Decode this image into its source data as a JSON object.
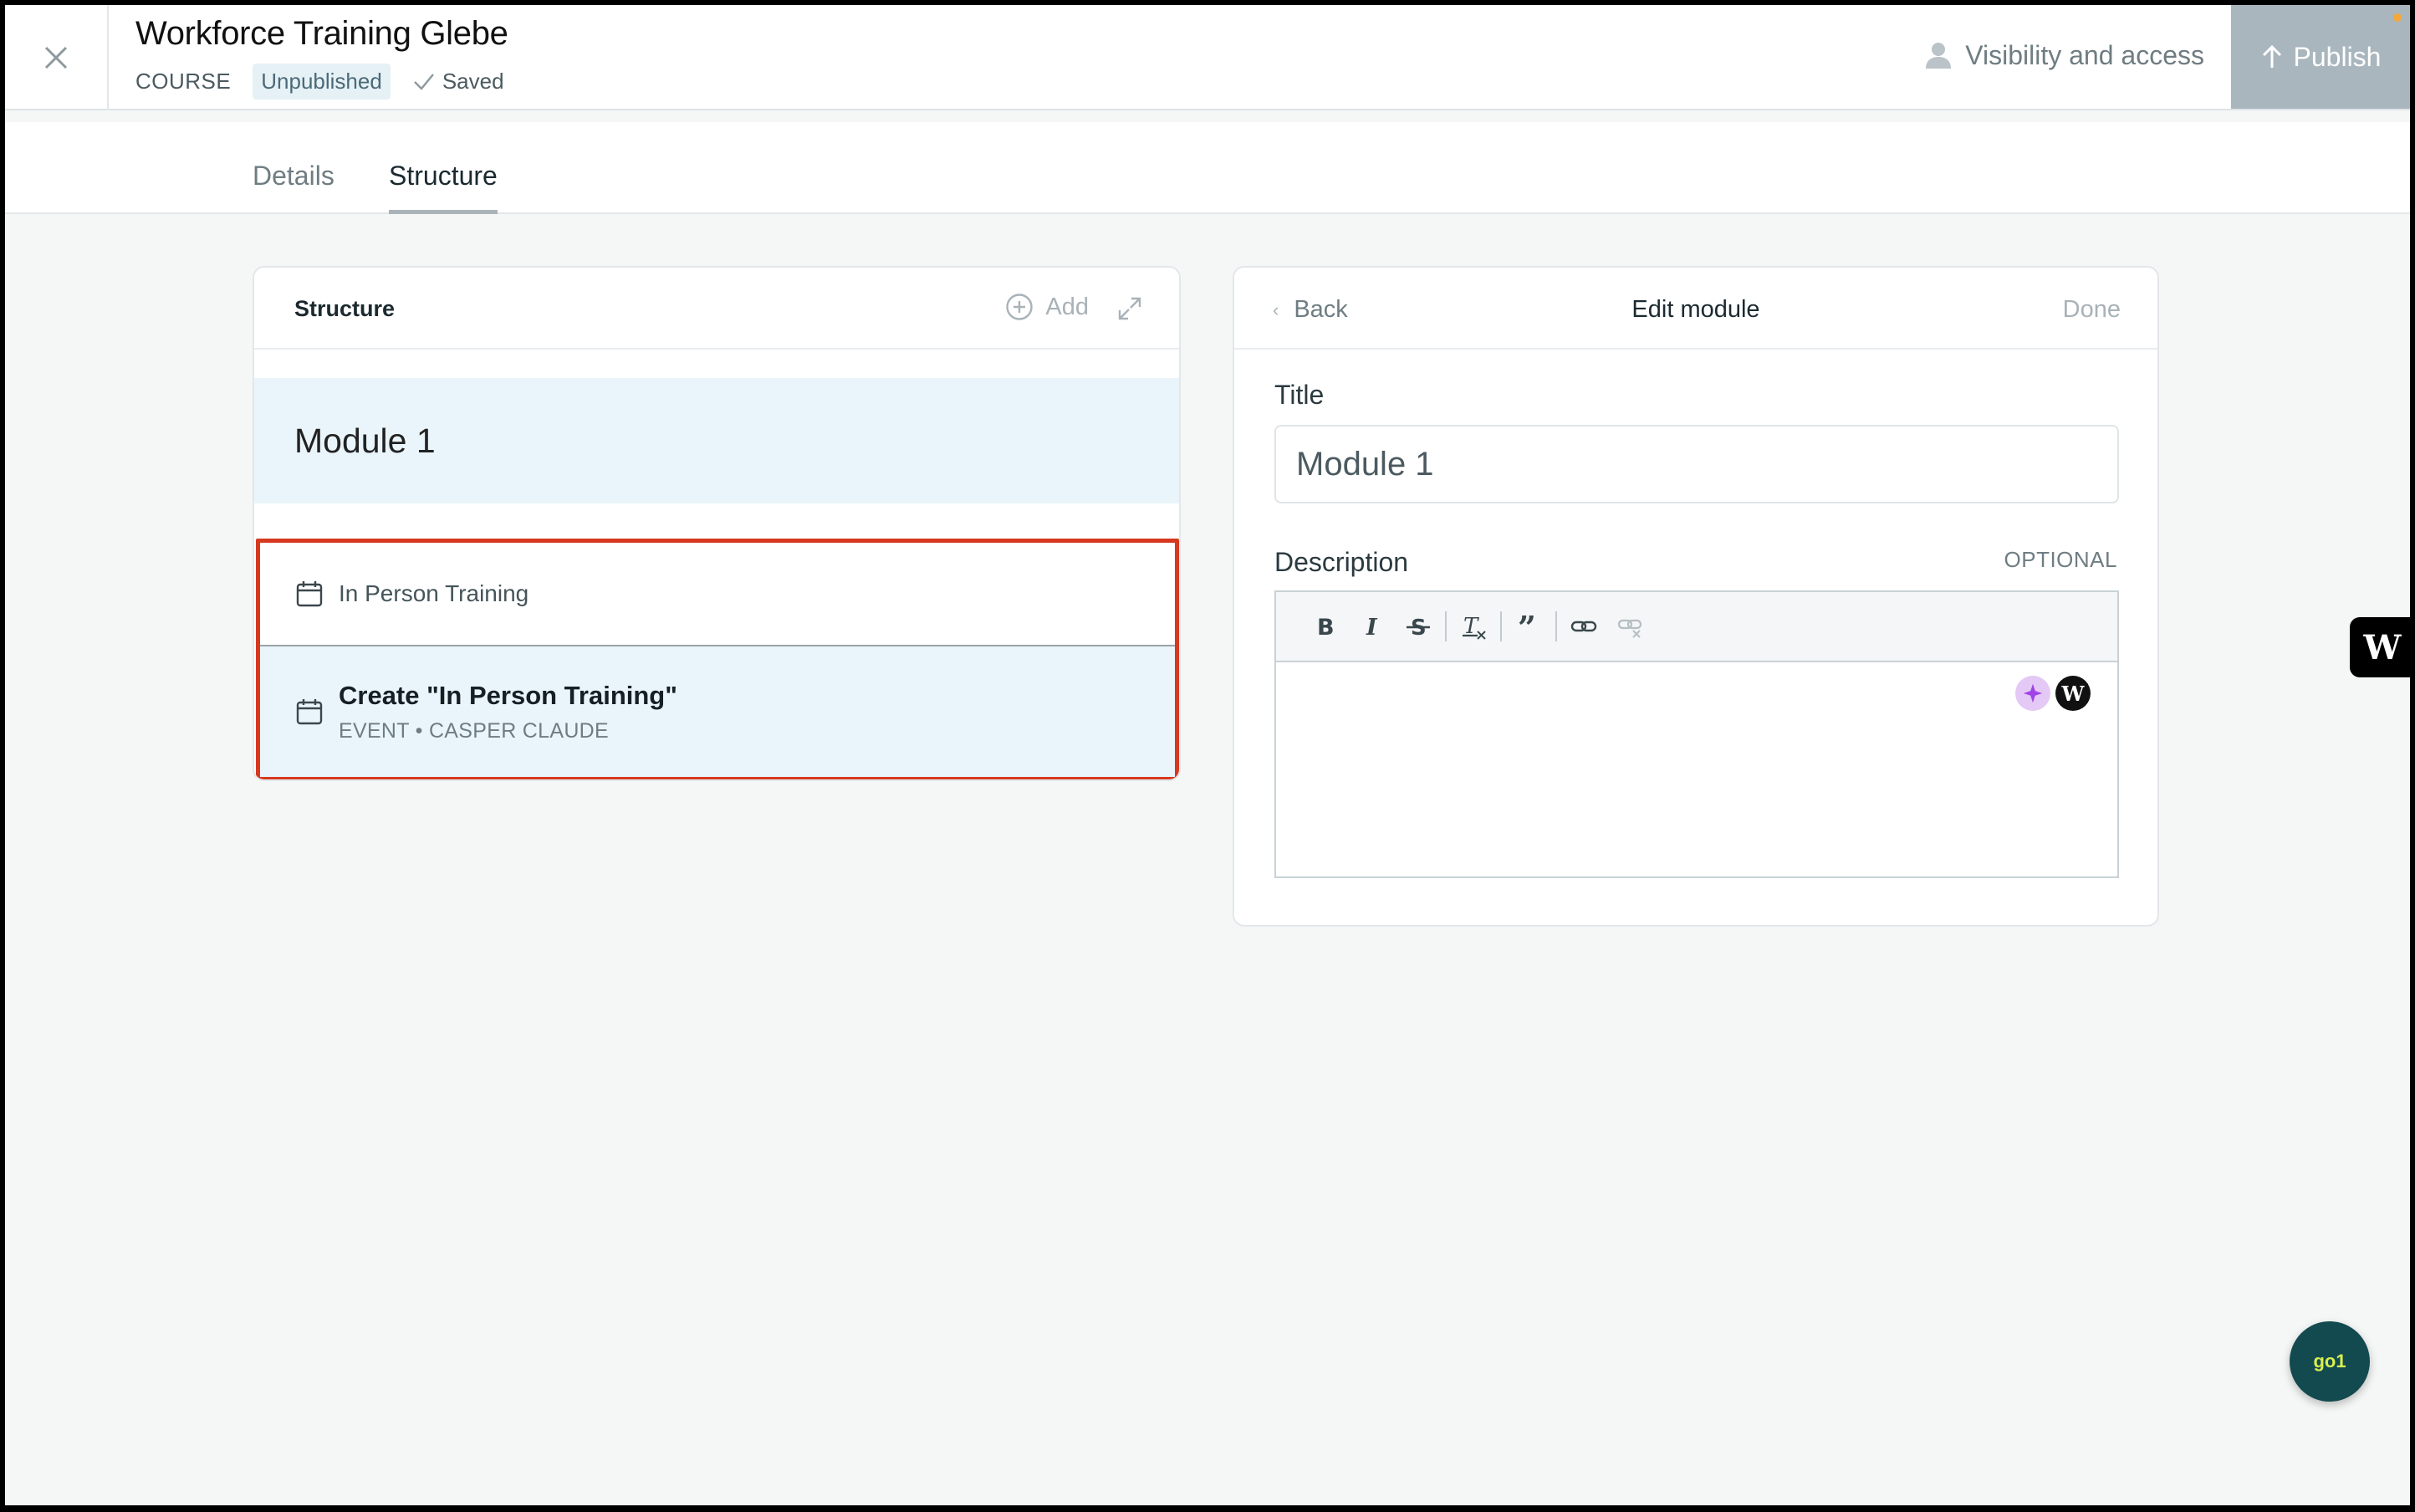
{
  "header": {
    "title": "Workforce Training Glebe",
    "type": "COURSE",
    "status": "Unpublished",
    "saved": "Saved",
    "visibility": "Visibility and access",
    "publish": "Publish"
  },
  "tabs": [
    {
      "label": "Details",
      "active": false
    },
    {
      "label": "Structure",
      "active": true
    }
  ],
  "structure_panel": {
    "heading": "Structure",
    "add": "Add",
    "module_title": "Module 1",
    "item_label": "In Person Training",
    "create_title": "Create \"In Person Training\"",
    "create_sub": "EVENT • CASPER CLAUDE"
  },
  "edit_panel": {
    "back": "Back",
    "heading": "Edit module",
    "done": "Done",
    "title_label": "Title",
    "title_value": "Module 1",
    "description_label": "Description",
    "optional": "OPTIONAL"
  },
  "toolbar": [
    "bold",
    "italic",
    "strikethrough",
    "clear-format",
    "quote",
    "link",
    "unlink"
  ],
  "widgets": {
    "side_logo": "W",
    "chat_logo": "go1",
    "ai_logo": "W"
  },
  "colors": {
    "accent_highlight": "#d6391f",
    "selected_bg": "#eaf5fb",
    "publish_bg": "#a9b6bd",
    "chat_bg": "#134a4f"
  }
}
